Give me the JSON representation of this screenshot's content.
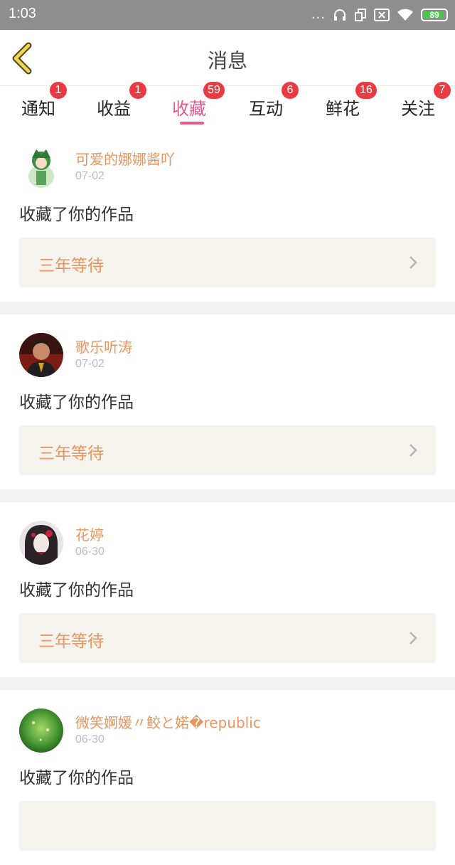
{
  "status": {
    "time": "1:03",
    "battery": "89",
    "dots": "..."
  },
  "header": {
    "title": "消息"
  },
  "tabs": [
    {
      "label": "通知",
      "badge": "1"
    },
    {
      "label": "收益",
      "badge": "1"
    },
    {
      "label": "收藏",
      "badge": "59",
      "active": true
    },
    {
      "label": "互动",
      "badge": "6"
    },
    {
      "label": "鲜花",
      "badge": "16"
    },
    {
      "label": "关注",
      "badge": "7"
    }
  ],
  "messages": [
    {
      "user": "可爱的娜娜酱吖",
      "date": "07-02",
      "action": "收藏了你的作品",
      "work": "三年等待"
    },
    {
      "user": "歌乐听涛",
      "date": "07-02",
      "action": "收藏了你的作品",
      "work": "三年等待"
    },
    {
      "user": "花婷",
      "date": "06-30",
      "action": "收藏了你的作品",
      "work": "三年等待"
    },
    {
      "user": "微笑婀媛〃鲛と婼�republic",
      "date": "06-30",
      "action": "收藏了你的作品",
      "work": ""
    }
  ],
  "colors": {
    "accent": "#e5588a",
    "badge": "#ea3a42",
    "username": "#e8965f"
  }
}
